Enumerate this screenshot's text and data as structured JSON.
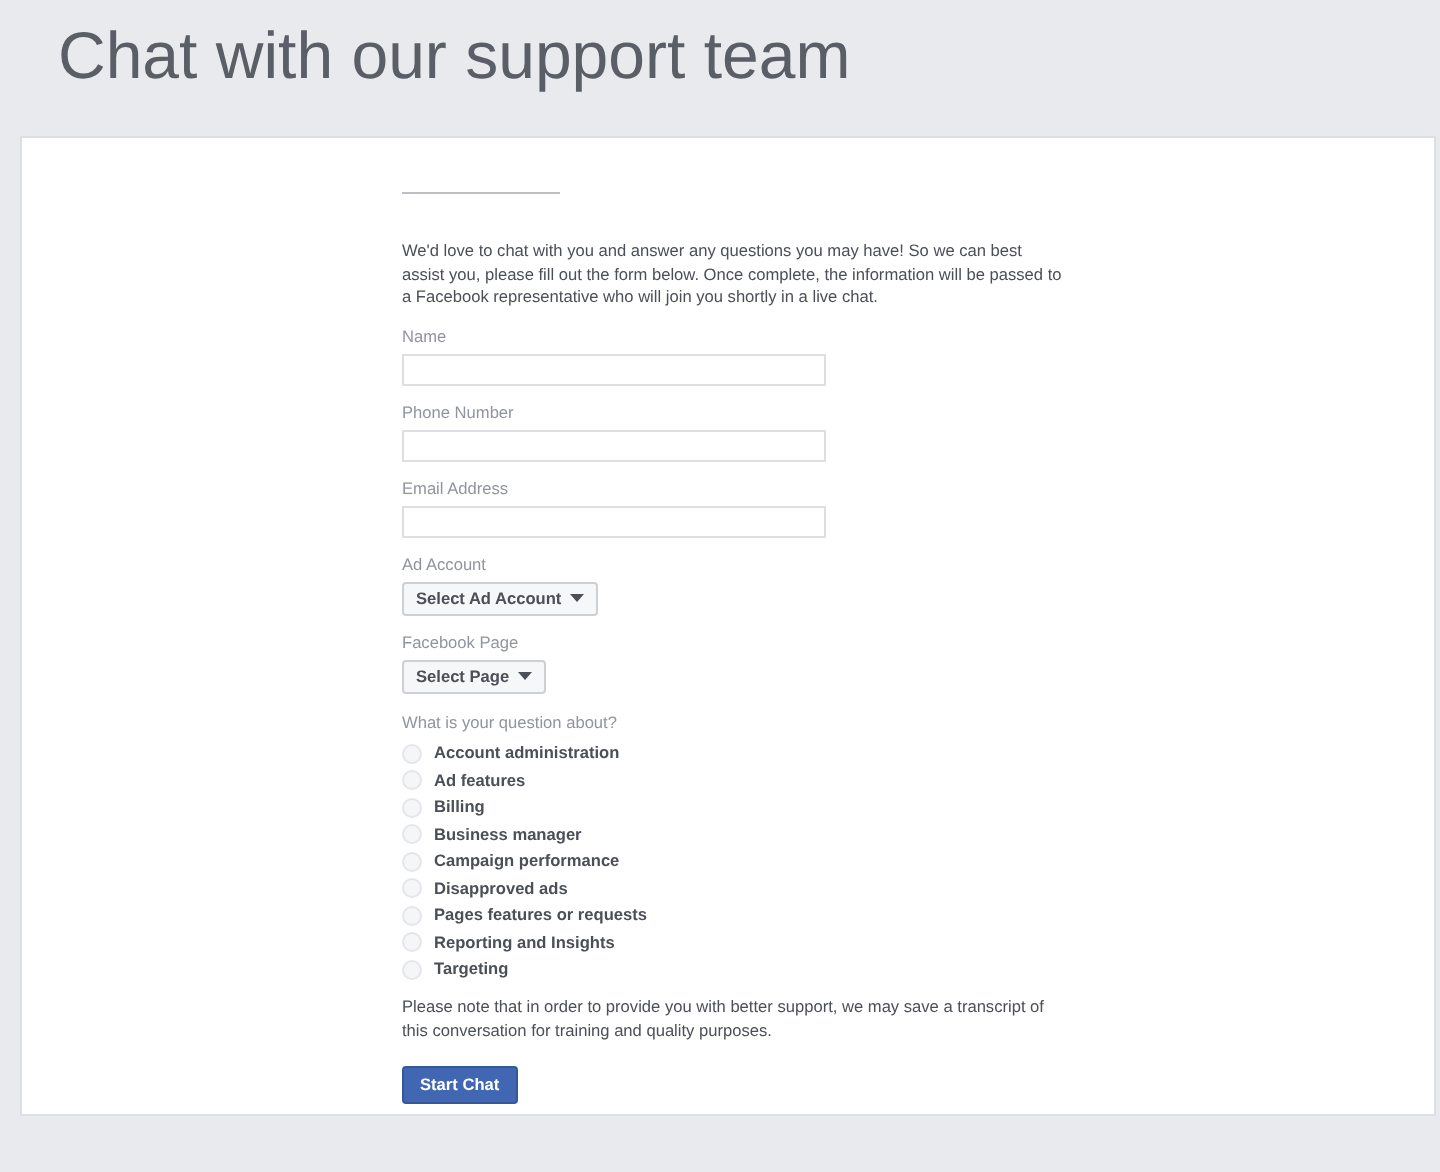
{
  "title": "Chat with our support team",
  "intro": "We'd love to chat with you and answer any questions you may have! So we can best assist you, please fill out the form below. Once complete, the information will be passed to a Facebook representative who will join you shortly in a live chat.",
  "fields": [
    {
      "kind": "text",
      "label": "Name"
    },
    {
      "kind": "text",
      "label": "Phone Number"
    },
    {
      "kind": "text",
      "label": "Email Address"
    },
    {
      "kind": "select",
      "label": "Ad Account",
      "button": "Select Ad Account"
    },
    {
      "kind": "select",
      "label": "Facebook Page",
      "button": "Select Page"
    }
  ],
  "question": {
    "label": "What is your question about?",
    "options": [
      {
        "label": "Account administration",
        "selected": false
      },
      {
        "label": "Ad features",
        "selected": false
      },
      {
        "label": "Billing",
        "selected": false
      },
      {
        "label": "Business manager",
        "selected": false
      },
      {
        "label": "Campaign performance",
        "selected": false
      },
      {
        "label": "Disapproved ads",
        "selected": false
      },
      {
        "label": "Pages features or requests",
        "selected": false
      },
      {
        "label": "Reporting and Insights",
        "selected": false
      },
      {
        "label": "Targeting",
        "selected": false
      }
    ]
  },
  "note": "Please note that in order to provide you with better support, we may save a transcript of this conversation for training and quality purposes.",
  "submit": "Start Chat"
}
